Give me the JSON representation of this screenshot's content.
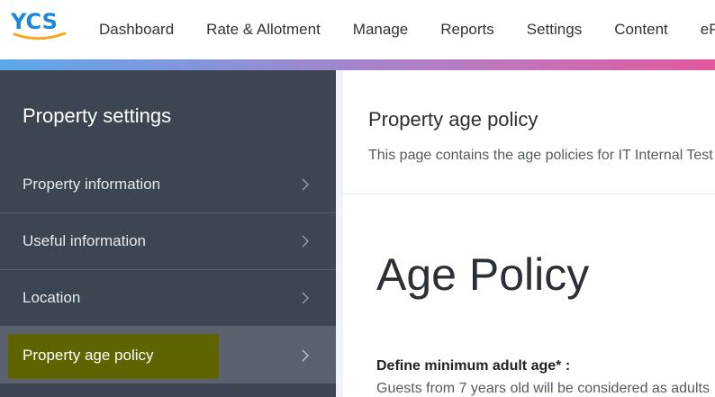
{
  "brand": {
    "logo_text": "YCS",
    "logo_color": "#1e88d8",
    "swoosh_color": "#f5a623"
  },
  "nav": {
    "items": [
      {
        "label": "Dashboard"
      },
      {
        "label": "Rate & Allotment"
      },
      {
        "label": "Manage"
      },
      {
        "label": "Reports"
      },
      {
        "label": "Settings"
      },
      {
        "label": "Content"
      },
      {
        "label": "eP"
      }
    ]
  },
  "sidebar": {
    "title": "Property settings",
    "items": [
      {
        "label": "Property information",
        "icon": "chevron-right-icon"
      },
      {
        "label": "Useful information",
        "icon": "chevron-right-icon"
      },
      {
        "label": "Location",
        "icon": "chevron-right-icon"
      },
      {
        "label": "Property age policy",
        "icon": "chevron-right-icon",
        "active": true
      }
    ]
  },
  "main": {
    "title": "Property age policy",
    "description": "This page contains the age policies for IT Internal Test",
    "heading": "Age Policy",
    "field_label": "Define minimum adult age* :",
    "field_text": "Guests from 7 years old will be considered as adults"
  },
  "colors": {
    "sidebar_bg": "#3c4653",
    "active_item_bg": "#59626e",
    "highlight": "#5e6400",
    "gradient": [
      "#5aa8ea",
      "#8f8fd6",
      "#c076be",
      "#e2589c"
    ]
  }
}
